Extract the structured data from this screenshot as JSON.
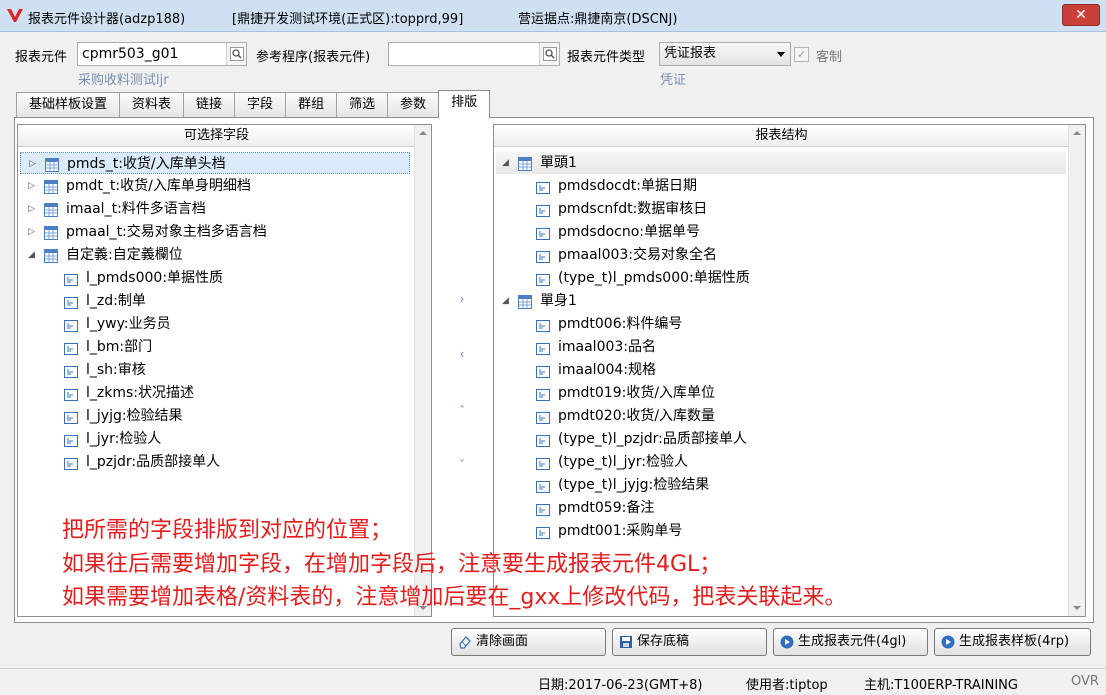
{
  "window": {
    "title": "报表元件设计器(adzp188)",
    "environment": "[鼎捷开发测试环境(正式区):topprd,99]",
    "site": "营运据点:鼎捷南京(DSCNJ)",
    "close_symbol": "✕"
  },
  "form": {
    "report_element_label": "报表元件",
    "report_element_value": "cpmr503_g01",
    "report_element_desc": "采购收料测试ljr",
    "reference_program_label": "参考程序(报表元件)",
    "reference_program_value": "",
    "element_type_label": "报表元件类型",
    "element_type_value": "凭证报表",
    "element_type_desc": "凭证",
    "custom_label": "客制",
    "custom_checked": true
  },
  "tabs": [
    {
      "label": "基础样板设置",
      "active": false
    },
    {
      "label": "资料表",
      "active": false
    },
    {
      "label": "链接",
      "active": false
    },
    {
      "label": "字段",
      "active": false
    },
    {
      "label": "群组",
      "active": false
    },
    {
      "label": "筛选",
      "active": false
    },
    {
      "label": "参数",
      "active": false
    },
    {
      "label": "排版",
      "active": true
    }
  ],
  "left_panel": {
    "header": "可选择字段",
    "tables": [
      {
        "label": "pmds_t:收货/入库单头档",
        "expanded": false,
        "selected": true
      },
      {
        "label": "pmdt_t:收货/入库单身明细档",
        "expanded": false,
        "selected": false
      },
      {
        "label": "imaal_t:料件多语言档",
        "expanded": false,
        "selected": false
      },
      {
        "label": "pmaal_t:交易对象主档多语言档",
        "expanded": false,
        "selected": false
      },
      {
        "label": "自定義:自定義欄位",
        "expanded": true,
        "selected": false
      }
    ],
    "custom_fields": [
      "l_pmds000:单据性质",
      "l_zd:制单",
      "l_ywy:业务员",
      "l_bm:部门",
      "l_sh:审核",
      "l_zkms:状况描述",
      "l_jyjg:检验结果",
      "l_jyr:检验人",
      "l_pzjdr:品质部接单人"
    ]
  },
  "move_controls": {
    "right": "›",
    "left": "‹",
    "up": "ˆ",
    "down": "ˇ"
  },
  "right_panel": {
    "header": "报表结构",
    "groups": [
      {
        "label": "單頭1",
        "items": [
          "pmdsdocdt:单据日期",
          "pmdscnfdt:数据审核日",
          "pmdsdocno:单据单号",
          "pmaal003:交易对象全名",
          "(type_t)l_pmds000:单据性质"
        ]
      },
      {
        "label": "單身1",
        "items": [
          "pmdt006:料件编号",
          "imaal003:品名",
          "imaal004:规格",
          "pmdt019:收货/入库单位",
          "pmdt020:收货/入库数量",
          "(type_t)l_pzjdr:品质部接单人",
          "(type_t)l_jyr:检验人",
          "(type_t)l_jyjg:检验结果",
          "pmdt059:备注",
          "pmdt001:采购单号"
        ]
      }
    ]
  },
  "annotation": [
    "把所需的字段排版到对应的位置；",
    "如果往后需要增加字段，在增加字段后，注意要生成报表元件4GL；",
    "如果需要增加表格/资料表的，注意增加后要在_gxx上修改代码，把表关联起来。"
  ],
  "buttons": {
    "clear": "清除画面",
    "save": "保存底稿",
    "gen_element": "生成报表元件(4gl)",
    "gen_template": "生成报表样板(4rp)"
  },
  "status": {
    "date": "日期:2017-06-23(GMT+8)",
    "user": "使用者:tiptop",
    "host": "主机:T100ERP-TRAINING",
    "mode": "OVR"
  },
  "colors": {
    "annotation": "#e41c1c",
    "titlebar": "#cfe0f3",
    "selection": "#dcebfc",
    "desc_text": "#7a8fb0"
  }
}
